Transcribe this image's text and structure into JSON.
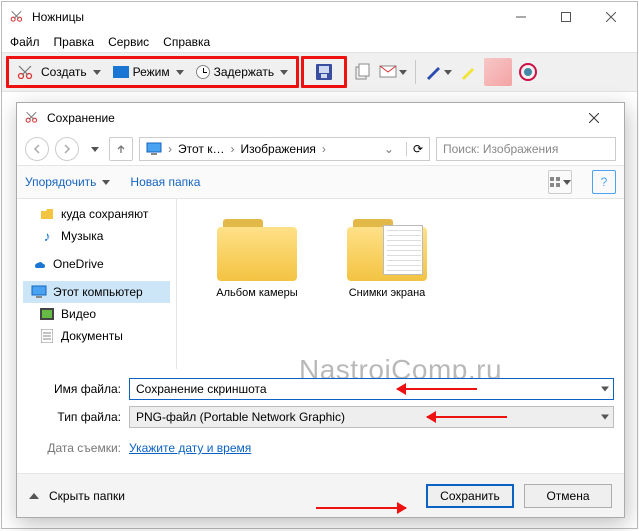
{
  "app": {
    "title": "Ножницы",
    "menu": [
      "Файл",
      "Правка",
      "Сервис",
      "Справка"
    ],
    "toolbar": {
      "create": "Создать",
      "mode": "Режим",
      "delay": "Задержать"
    }
  },
  "dialog": {
    "title": "Сохранение",
    "breadcrumb": {
      "root": "Этот к…",
      "folder": "Изображения"
    },
    "search_placeholder": "Поиск: Изображения",
    "toolbar": {
      "organize": "Упорядочить",
      "new_folder": "Новая папка"
    },
    "nav": [
      {
        "label": "куда сохраняют",
        "icon": "folder",
        "indent": 1
      },
      {
        "label": "Музыка",
        "icon": "music",
        "indent": 1
      },
      {
        "label": "OneDrive",
        "icon": "onedrive",
        "indent": 0
      },
      {
        "label": "Этот компьютер",
        "icon": "pc",
        "indent": 0,
        "selected": true
      },
      {
        "label": "Видео",
        "icon": "video",
        "indent": 1
      },
      {
        "label": "Документы",
        "icon": "docs",
        "indent": 1
      }
    ],
    "folders": [
      {
        "name": "Альбом камеры",
        "has_content": false
      },
      {
        "name": "Снимки экрана",
        "has_content": true
      }
    ],
    "form": {
      "name_label": "Имя файла:",
      "name_value": "Сохранение скриншота",
      "type_label": "Тип файла:",
      "type_value": "PNG-файл (Portable Network Graphic)",
      "date_label": "Дата съемки:",
      "date_link": "Укажите дату и время"
    },
    "bottom": {
      "hide_folders": "Скрыть папки",
      "save": "Сохранить",
      "cancel": "Отмена"
    }
  },
  "watermark": "NastrojComp.ru"
}
